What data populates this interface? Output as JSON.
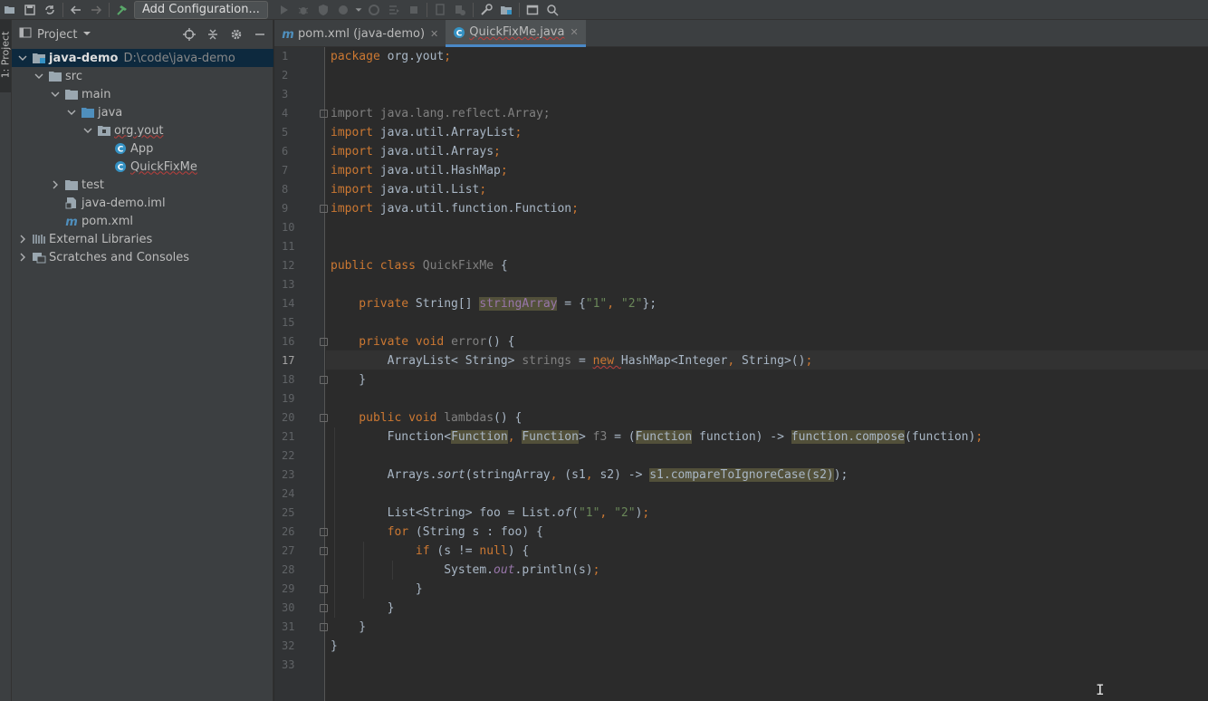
{
  "toolbar": {
    "config_label": "Add Configuration...",
    "icons": [
      "folder-icon",
      "save-icon",
      "sync-icon",
      "back-icon",
      "forward-icon",
      "hammer-icon",
      "run-icon",
      "debug-icon",
      "coverage-icon",
      "profile-icon",
      "dropdown-icon",
      "build-icon",
      "stop-icon",
      "device-icon",
      "attach-icon",
      "wrench-icon",
      "project-structure-icon",
      "frame-icon",
      "search-icon"
    ]
  },
  "side_strip": {
    "label": "1: Project"
  },
  "project_panel": {
    "title": "Project",
    "tree": [
      {
        "label": "java-demo",
        "hint": "D:\\code\\java-demo",
        "depth": 0,
        "expanded": true,
        "icon": "module-icon",
        "bold": true,
        "selected": true
      },
      {
        "label": "src",
        "depth": 1,
        "expanded": true,
        "icon": "folder-icon"
      },
      {
        "label": "main",
        "depth": 2,
        "expanded": true,
        "icon": "folder-icon"
      },
      {
        "label": "java",
        "depth": 3,
        "expanded": true,
        "icon": "source-folder-icon"
      },
      {
        "label": "org.yout",
        "depth": 4,
        "expanded": true,
        "icon": "package-icon",
        "error": true
      },
      {
        "label": "App",
        "depth": 5,
        "icon": "class-icon"
      },
      {
        "label": "QuickFixMe",
        "depth": 5,
        "icon": "class-icon",
        "error": true
      },
      {
        "label": "test",
        "depth": 2,
        "expanded": false,
        "icon": "folder-icon"
      },
      {
        "label": "java-demo.iml",
        "depth": 2,
        "icon": "iml-file-icon"
      },
      {
        "label": "pom.xml",
        "depth": 2,
        "icon": "maven-icon"
      },
      {
        "label": "External Libraries",
        "depth": 0,
        "expanded": false,
        "icon": "libraries-icon"
      },
      {
        "label": "Scratches and Consoles",
        "depth": 0,
        "expanded": false,
        "icon": "scratches-icon"
      }
    ]
  },
  "tabs": [
    {
      "label": "pom.xml (java-demo)",
      "icon": "maven-icon",
      "active": false
    },
    {
      "label": "QuickFixMe.java",
      "icon": "class-icon",
      "active": true,
      "error": true
    }
  ],
  "editor": {
    "current_line": 17,
    "line_numbers": [
      "1",
      "2",
      "3",
      "4",
      "5",
      "6",
      "7",
      "8",
      "9",
      "10",
      "11",
      "12",
      "13",
      "14",
      "15",
      "16",
      "17",
      "18",
      "19",
      "20",
      "21",
      "22",
      "23",
      "24",
      "25",
      "26",
      "27",
      "28",
      "29",
      "30",
      "31",
      "32",
      "33"
    ],
    "lines": [
      [
        [
          "package ",
          "kw"
        ],
        [
          "org.yout",
          ""
        ],
        [
          ";",
          "kw"
        ]
      ],
      [],
      [],
      [
        [
          "import ",
          "gray"
        ],
        [
          "java.lang.reflect.Array;",
          "gray"
        ]
      ],
      [
        [
          "import ",
          "kw"
        ],
        [
          "java.util.ArrayList",
          ""
        ],
        [
          ";",
          "kw"
        ]
      ],
      [
        [
          "import ",
          "kw"
        ],
        [
          "java.util.Arrays",
          ""
        ],
        [
          ";",
          "kw"
        ]
      ],
      [
        [
          "import ",
          "kw"
        ],
        [
          "java.util.HashMap",
          ""
        ],
        [
          ";",
          "kw"
        ]
      ],
      [
        [
          "import ",
          "kw"
        ],
        [
          "java.util.List",
          ""
        ],
        [
          ";",
          "kw"
        ]
      ],
      [
        [
          "import ",
          "kw"
        ],
        [
          "java.util.function.Function",
          ""
        ],
        [
          ";",
          "kw"
        ]
      ],
      [],
      [],
      [
        [
          "public class ",
          "kw"
        ],
        [
          "QuickFixMe",
          "gray"
        ],
        [
          " {",
          ""
        ]
      ],
      [],
      [
        [
          "    private ",
          "kw"
        ],
        [
          "String[] ",
          ""
        ],
        [
          "stringArray",
          "fld warn"
        ],
        [
          " = {",
          ""
        ],
        [
          "\"1\"",
          "str"
        ],
        [
          ", ",
          "kw"
        ],
        [
          "\"2\"",
          "str"
        ],
        [
          "};",
          ""
        ]
      ],
      [],
      [
        [
          "    private void ",
          "kw"
        ],
        [
          "error",
          "gray"
        ],
        [
          "() {",
          ""
        ]
      ],
      [
        [
          "        ArrayList< String> ",
          ""
        ],
        [
          "strings",
          "gray"
        ],
        [
          " = ",
          ""
        ],
        [
          "new ",
          "kw wavy"
        ],
        [
          "HashMap<Integer",
          ""
        ],
        [
          ", ",
          "kw"
        ],
        [
          "String>()",
          ""
        ],
        [
          ";",
          "kw"
        ]
      ],
      [
        [
          "    }",
          ""
        ]
      ],
      [],
      [
        [
          "    public void ",
          "kw"
        ],
        [
          "lambdas",
          "gray"
        ],
        [
          "() {",
          ""
        ]
      ],
      [
        [
          "        Function<",
          ""
        ],
        [
          "Function",
          "warn"
        ],
        [
          ", ",
          "kw"
        ],
        [
          "Function",
          "warn"
        ],
        [
          "> ",
          ""
        ],
        [
          "f3",
          "gray"
        ],
        [
          " = (",
          ""
        ],
        [
          "Function",
          "warn"
        ],
        [
          " function) -> ",
          ""
        ],
        [
          "function.compose",
          "warn"
        ],
        [
          "(function)",
          ""
        ],
        [
          ";",
          "kw"
        ]
      ],
      [],
      [
        [
          "        Arrays.",
          ""
        ],
        [
          "sort",
          "it"
        ],
        [
          "(stringArray",
          ""
        ],
        [
          ", ",
          "kw"
        ],
        [
          "(s1",
          ""
        ],
        [
          ", ",
          "kw"
        ],
        [
          "s2) -> ",
          ""
        ],
        [
          "s1.compareToIgnoreCase(s2)",
          "warn"
        ],
        [
          ");",
          ""
        ]
      ],
      [],
      [
        [
          "        List<String> foo = List.",
          ""
        ],
        [
          "of",
          "it"
        ],
        [
          "(",
          ""
        ],
        [
          "\"1\"",
          "str"
        ],
        [
          ", ",
          "kw"
        ],
        [
          "\"2\"",
          "str"
        ],
        [
          ")",
          ""
        ],
        [
          ";",
          "kw"
        ]
      ],
      [
        [
          "        for ",
          "kw"
        ],
        [
          "(String s : foo) {",
          ""
        ]
      ],
      [
        [
          "            if ",
          "kw"
        ],
        [
          "(s != ",
          ""
        ],
        [
          "null",
          "kw"
        ],
        [
          ") {",
          ""
        ]
      ],
      [
        [
          "                System.",
          ""
        ],
        [
          "out",
          "fld it"
        ],
        [
          ".println(s)",
          ""
        ],
        [
          ";",
          "kw"
        ]
      ],
      [
        [
          "            }",
          ""
        ]
      ],
      [
        [
          "        }",
          ""
        ]
      ],
      [
        [
          "    }",
          ""
        ]
      ],
      [
        [
          "}",
          ""
        ]
      ],
      []
    ]
  }
}
